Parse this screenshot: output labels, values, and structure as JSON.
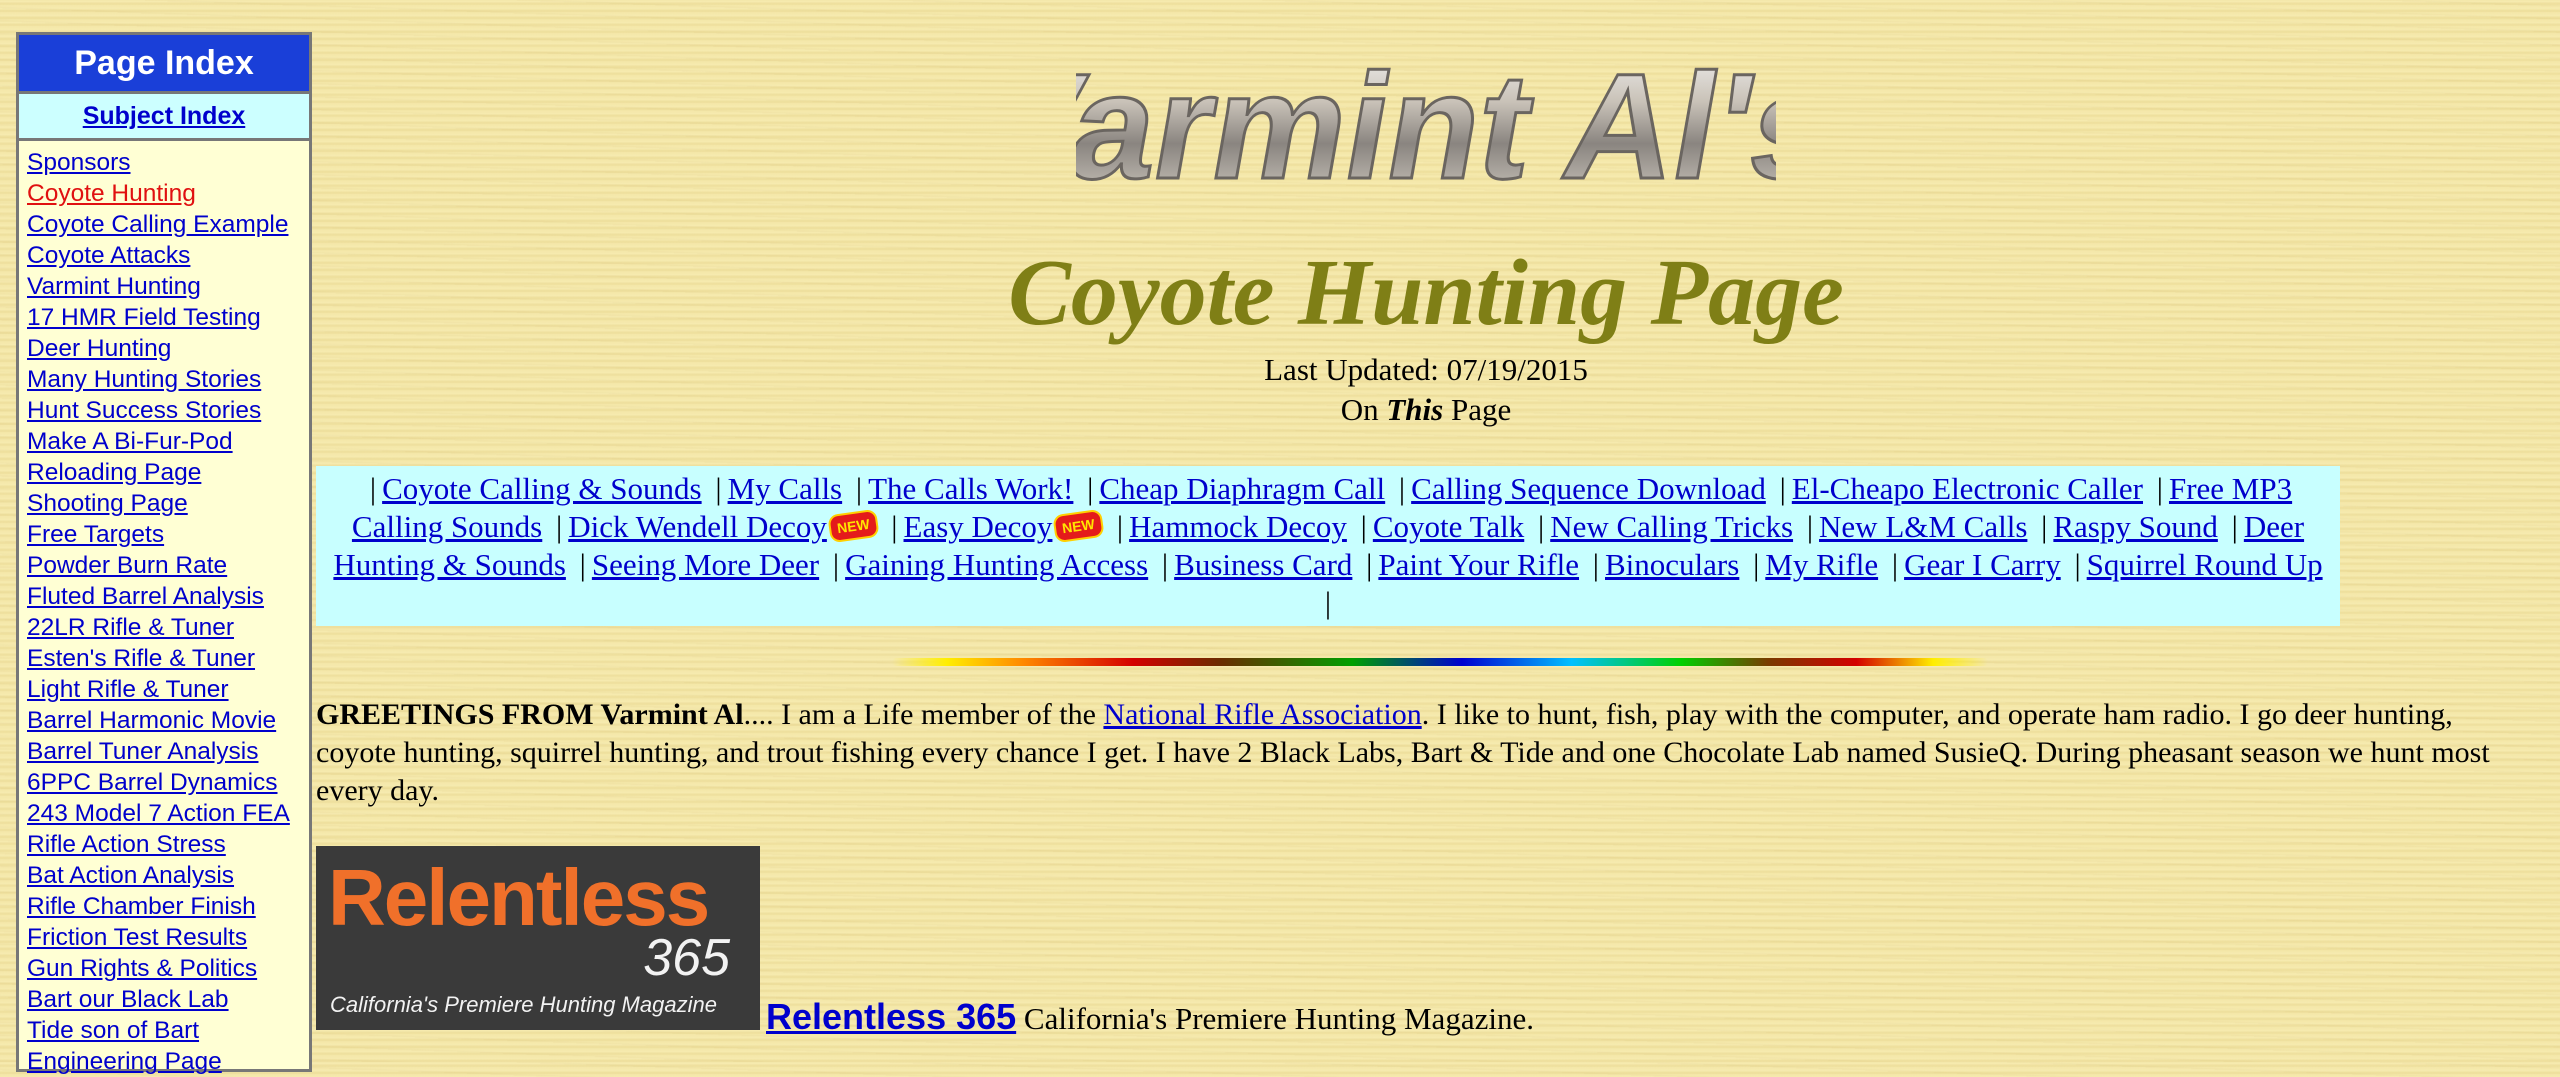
{
  "sidebar": {
    "title": "Page Index",
    "subject_link": "Subject Index",
    "items": [
      {
        "label": "Sponsors"
      },
      {
        "label": "Coyote Hunting",
        "active": true
      },
      {
        "label": "Coyote Calling Example"
      },
      {
        "label": "Coyote Attacks"
      },
      {
        "label": "Varmint Hunting"
      },
      {
        "label": "17 HMR Field Testing"
      },
      {
        "label": "Deer Hunting"
      },
      {
        "label": "Many Hunting Stories"
      },
      {
        "label": "Hunt Success Stories"
      },
      {
        "label": "Make A Bi-Fur-Pod"
      },
      {
        "label": "Reloading Page"
      },
      {
        "label": "Shooting Page"
      },
      {
        "label": "Free Targets"
      },
      {
        "label": "Powder Burn Rate"
      },
      {
        "label": "Fluted Barrel Analysis"
      },
      {
        "label": "22LR Rifle & Tuner"
      },
      {
        "label": "Esten's Rifle & Tuner"
      },
      {
        "label": "Light Rifle & Tuner"
      },
      {
        "label": "Barrel Harmonic Movie"
      },
      {
        "label": "Barrel Tuner Analysis"
      },
      {
        "label": "6PPC Barrel Dynamics"
      },
      {
        "label": "243 Model 7 Action FEA"
      },
      {
        "label": "Rifle Action Stress"
      },
      {
        "label": "Bat Action Analysis"
      },
      {
        "label": "Rifle Chamber Finish"
      },
      {
        "label": "Friction Test Results"
      },
      {
        "label": "Gun Rights & Politics"
      },
      {
        "label": "Bart our Black Lab"
      },
      {
        "label": "Tide son of Bart"
      },
      {
        "label": "Engineering Page"
      }
    ]
  },
  "header": {
    "logo_text": "Varmint Al's",
    "title": "Coyote Hunting Page",
    "updated": "Last Updated: 07/19/2015",
    "on_this_prefix": "On ",
    "on_this_em": "This",
    "on_this_suffix": " Page"
  },
  "nav": {
    "links": [
      {
        "label": "Coyote Calling & Sounds"
      },
      {
        "label": "My Calls"
      },
      {
        "label": "The Calls Work!"
      },
      {
        "label": "Cheap Diaphragm Call"
      },
      {
        "label": "Calling Sequence Download"
      },
      {
        "label": "El-Cheapo Electronic Caller"
      },
      {
        "label": "Free MP3 Calling Sounds"
      },
      {
        "label": "Dick Wendell Decoy",
        "new": true
      },
      {
        "label": "Easy Decoy",
        "new": true
      },
      {
        "label": "Hammock Decoy"
      },
      {
        "label": "Coyote Talk"
      },
      {
        "label": "New Calling Tricks"
      },
      {
        "label": "New L&M Calls"
      },
      {
        "label": "Raspy Sound"
      },
      {
        "label": "Deer Hunting & Sounds"
      },
      {
        "label": "Seeing More Deer"
      },
      {
        "label": "Gaining Hunting Access"
      },
      {
        "label": "Business Card"
      },
      {
        "label": "Paint Your Rifle"
      },
      {
        "label": "Binoculars"
      },
      {
        "label": "My Rifle"
      },
      {
        "label": "Gear I Carry"
      },
      {
        "label": "Squirrel Round Up"
      }
    ],
    "new_badge": "NEW"
  },
  "greeting": {
    "bold": "GREETINGS FROM Varmint Al",
    "before_link": ".... I am a Life member of the ",
    "link": "National Rifle Association",
    "after_link": ". I like to hunt, fish, play with the computer, and operate ham radio. I go deer hunting, coyote hunting, squirrel hunting, and trout fishing every chance I get. I have 2 Black Labs, Bart & Tide and one Chocolate Lab named SusieQ. During pheasant season we hunt most every day."
  },
  "sponsor": {
    "logo_main": "Relentless",
    "logo_num": "365",
    "logo_tag": "California's Premiere Hunting Magazine",
    "link": " Relentless 365",
    "desc": " California's Premiere Hunting Magazine."
  },
  "colors": {
    "sidebar_header": "#1a3fd8",
    "subject_bg": "#ccffff",
    "active_link": "#e01010",
    "title": "#7f7f16",
    "nav_bg": "#c8ffff"
  }
}
